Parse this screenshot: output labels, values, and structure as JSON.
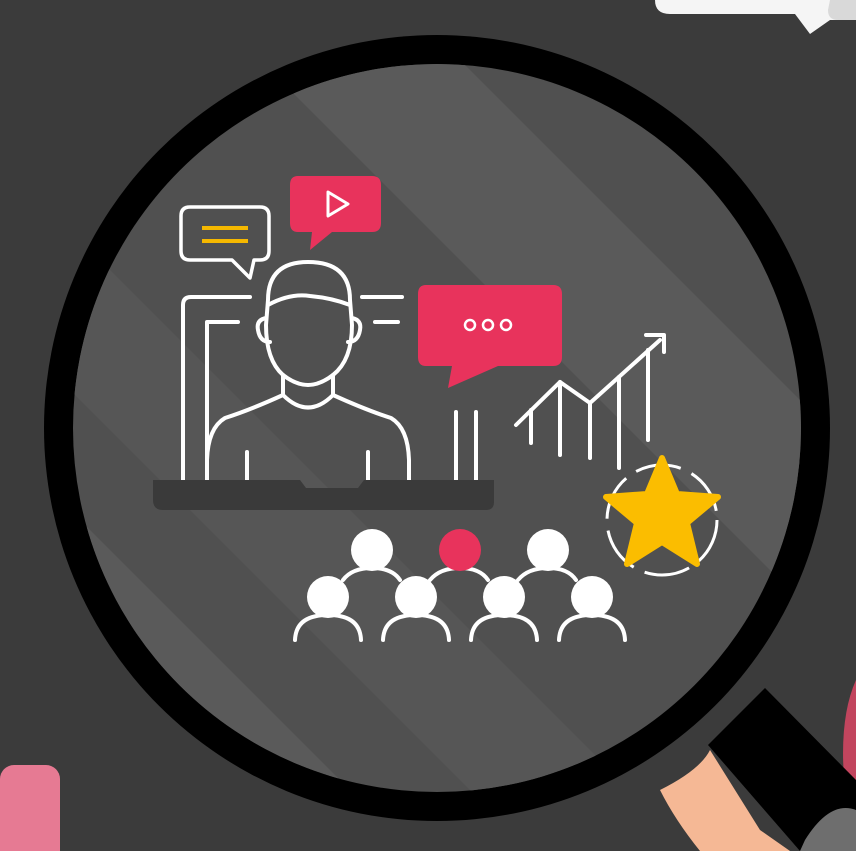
{
  "scene": {
    "background_color": "#3b3b3b",
    "lens_color": "#525252",
    "rim_color": "#000000",
    "accent_color": "#e8335c",
    "star_color": "#fbbd00",
    "highlight_color": "#f5b800",
    "skin_color": "#f5b895",
    "icons": [
      "magnifying-glass-icon",
      "presenter-icon",
      "chat-bubble-icon",
      "video-play-bubble-icon",
      "typing-bubble-icon",
      "growth-chart-icon",
      "star-rating-icon",
      "audience-icon"
    ]
  }
}
